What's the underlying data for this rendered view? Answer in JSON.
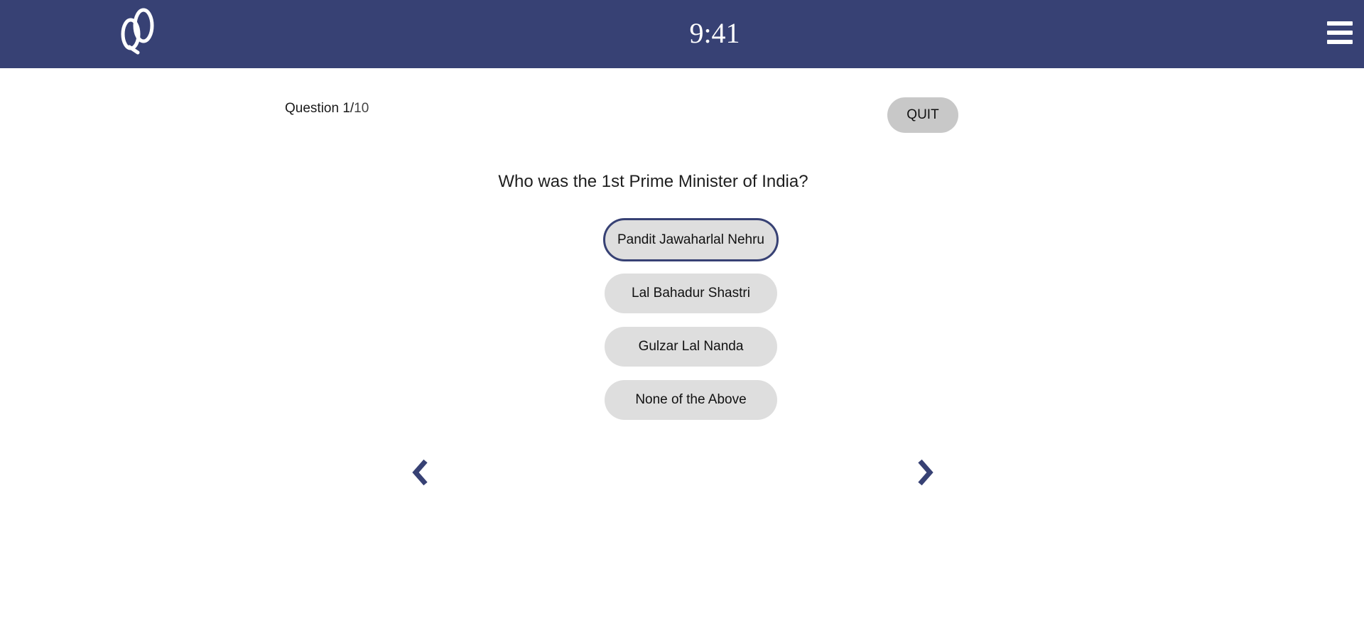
{
  "header": {
    "logo_icon": "quiz-logo-icon",
    "time": "9:41",
    "menu_icon": "hamburger-menu-icon",
    "background": "#374174"
  },
  "quiz": {
    "counter_label": "Question 1/",
    "counter_total": "10",
    "quit_label": "QUIT",
    "question": "Who was the 1st Prime Minister of India?",
    "options": [
      {
        "label": "Pandit Jawaharlal Nehru",
        "selected": true
      },
      {
        "label": "Lal Bahadur Shastri",
        "selected": false
      },
      {
        "label": "Gulzar Lal Nanda",
        "selected": false
      },
      {
        "label": "None of the Above",
        "selected": false
      }
    ],
    "prev_icon": "chevron-left-icon",
    "next_icon": "chevron-right-icon",
    "accent": "#374174"
  }
}
